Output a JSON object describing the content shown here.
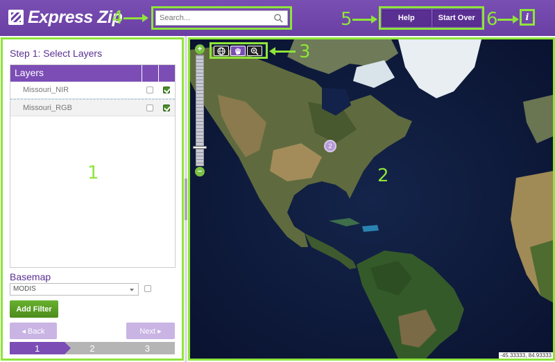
{
  "header": {
    "logo_text": "Express Zip",
    "search": {
      "placeholder": "Search..."
    },
    "help_label": "Help",
    "start_over_label": "Start Over",
    "info_label": "i"
  },
  "annotations": {
    "a1": "1",
    "a2": "2",
    "a3": "3",
    "a4": "4",
    "a5": "5",
    "a6": "6"
  },
  "left_panel": {
    "step_title": "Step 1: Select Layers",
    "layers_header": "Layers",
    "layers": [
      {
        "name": "Missouri_NIR",
        "selected": false,
        "checked": true
      },
      {
        "name": "Missouri_RGB",
        "selected": true,
        "checked": true
      }
    ],
    "basemap_label": "Basemap",
    "basemap_value": "MODIS",
    "add_filter_label": "Add Filter",
    "back_label": "◂ Back",
    "next_label": "Next ▸",
    "steps": [
      "1",
      "2",
      "3"
    ],
    "active_step": 1
  },
  "map": {
    "zoom_in_label": "+",
    "zoom_out_label": "−",
    "cluster_count": "2",
    "coords": "-45.33333, 84.93333",
    "tools": [
      "globe-icon",
      "hand-pan-icon",
      "zoom-in-icon"
    ]
  },
  "colors": {
    "accent_purple": "#6a3fa4",
    "annotation_green": "#8ee53a",
    "button_green": "#5aa025"
  }
}
